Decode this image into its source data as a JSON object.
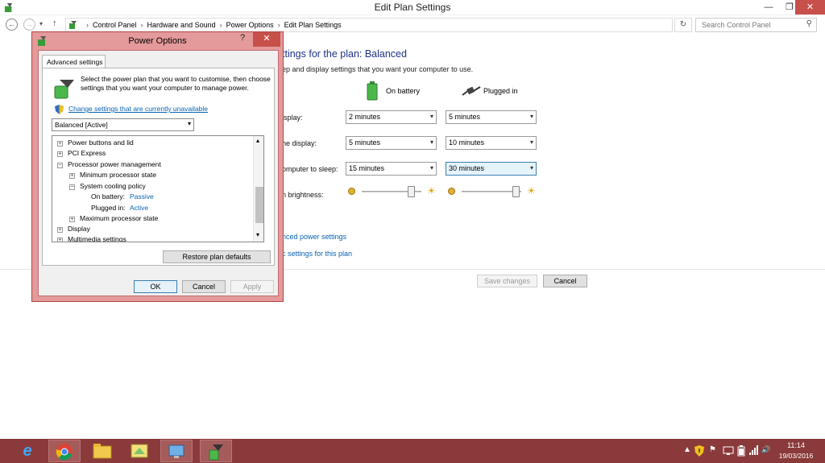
{
  "window": {
    "title": "Edit Plan Settings",
    "min_glyph": "—",
    "max_glyph": "❐",
    "close_glyph": "✕"
  },
  "nav": {
    "back": "←",
    "forward": "→",
    "recent": "▾",
    "up": "↑",
    "breadcrumbs": [
      "Control Panel",
      "Hardware and Sound",
      "Power Options",
      "Edit Plan Settings"
    ],
    "separator": "›",
    "dropdown": "⌄",
    "refresh": "↻",
    "search_placeholder": "Search Control Panel",
    "search_icon": "⚲"
  },
  "main": {
    "heading": "ttings for the plan: Balanced",
    "description": "ep and display settings that you want your computer to use.",
    "column_battery": "On battery",
    "column_plugged": "Plugged in",
    "rows": [
      {
        "label": "isplay:",
        "battery": "2 minutes",
        "plugged": "5 minutes"
      },
      {
        "label": "he display:",
        "battery": "5 minutes",
        "plugged": "10 minutes"
      },
      {
        "label": "omputer to sleep:",
        "battery": "15 minutes",
        "plugged": "30 minutes"
      }
    ],
    "brightness_label": "n brightness:",
    "brightness_battery": 0.88,
    "brightness_plugged": 0.97,
    "link_advanced": "nced power settings",
    "link_restore": "c settings for this plan",
    "save_label": "Save changes",
    "cancel_label": "Cancel"
  },
  "dialog": {
    "title": "Power Options",
    "help": "?",
    "close": "✕",
    "tab": "Advanced settings",
    "description": "Select the power plan that you want to customise, then choose settings that you want your computer to manage power.",
    "change_link": "Change settings that are currently unavailable",
    "plan_select": "Balanced [Active]",
    "tree": [
      {
        "text": "Power buttons and lid",
        "exp": "+"
      },
      {
        "text": "PCI Express",
        "exp": "+"
      },
      {
        "text": "Processor power management",
        "exp": "−"
      },
      {
        "text": "Minimum processor state",
        "exp": "+"
      },
      {
        "text": "System cooling policy",
        "exp": "−"
      },
      {
        "text": "On battery:",
        "value": "Passive"
      },
      {
        "text": "Plugged in:",
        "value": "Active"
      },
      {
        "text": "Maximum processor state",
        "exp": "+"
      },
      {
        "text": "Display",
        "exp": "+"
      },
      {
        "text": "Multimedia settings",
        "exp": "+"
      }
    ],
    "restore_label": "Restore plan defaults",
    "ok_label": "OK",
    "cancel_label": "Cancel",
    "apply_label": "Apply"
  },
  "taskbar": {
    "time": "11:14",
    "date": "19/03/2016",
    "ie_glyph": "e",
    "tray_chevron": "▲",
    "tray_flag": "⚑",
    "tray_speaker": "🔊"
  },
  "colors": {
    "dialog_frame": "#e49a9a",
    "close_red": "#c7504b",
    "taskbar": "#8a3a3a",
    "link_blue": "#0a62b0",
    "heading_blue": "#1e3287"
  }
}
